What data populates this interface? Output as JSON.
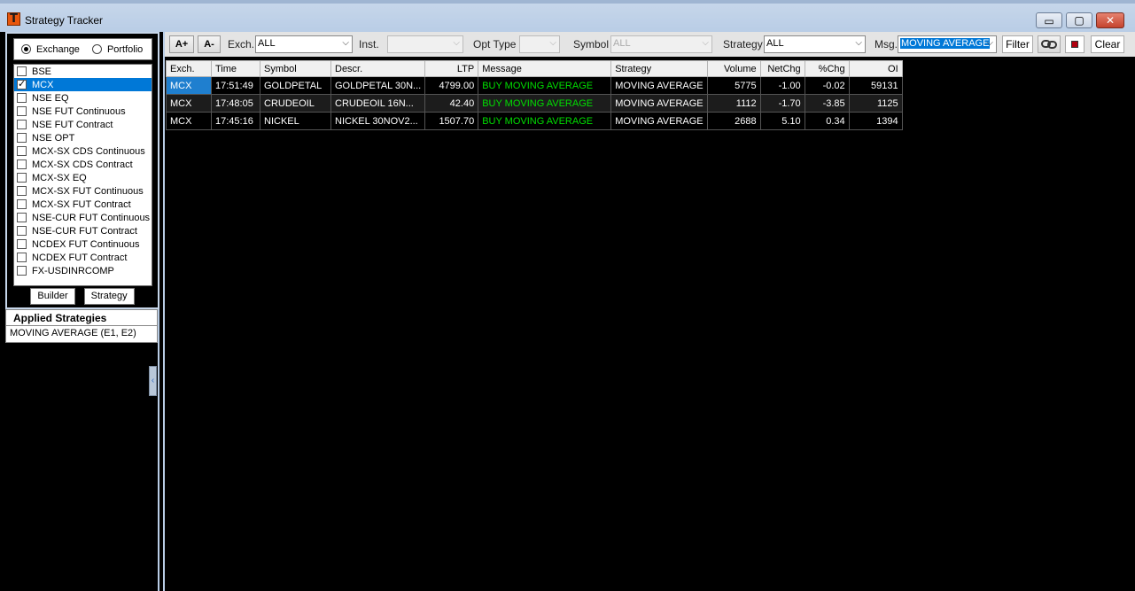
{
  "window": {
    "title": "Strategy Tracker",
    "icon": "T",
    "minimize": "▭",
    "maximize": "▢",
    "close": "✕"
  },
  "left": {
    "mode_options": [
      {
        "label": "Exchange",
        "selected": true
      },
      {
        "label": "Portfolio",
        "selected": false
      }
    ],
    "exchanges": [
      {
        "label": "BSE",
        "checked": false,
        "selected": false
      },
      {
        "label": "MCX",
        "checked": true,
        "selected": true
      },
      {
        "label": "NSE EQ",
        "checked": false,
        "selected": false
      },
      {
        "label": "NSE FUT Continuous",
        "checked": false,
        "selected": false
      },
      {
        "label": "NSE FUT Contract",
        "checked": false,
        "selected": false
      },
      {
        "label": "NSE OPT",
        "checked": false,
        "selected": false
      },
      {
        "label": "MCX-SX CDS Continuous",
        "checked": false,
        "selected": false
      },
      {
        "label": "MCX-SX CDS Contract",
        "checked": false,
        "selected": false
      },
      {
        "label": "MCX-SX EQ",
        "checked": false,
        "selected": false
      },
      {
        "label": "MCX-SX FUT Continuous",
        "checked": false,
        "selected": false
      },
      {
        "label": "MCX-SX FUT Contract",
        "checked": false,
        "selected": false
      },
      {
        "label": "NSE-CUR FUT Continuous",
        "checked": false,
        "selected": false
      },
      {
        "label": "NSE-CUR FUT Contract",
        "checked": false,
        "selected": false
      },
      {
        "label": "NCDEX FUT Continuous",
        "checked": false,
        "selected": false
      },
      {
        "label": "NCDEX FUT Contract",
        "checked": false,
        "selected": false
      },
      {
        "label": "FX-USDINRCOMP",
        "checked": false,
        "selected": false
      }
    ],
    "builder_label": "Builder",
    "strategy_label": "Strategy",
    "applied_title": "Applied Strategies",
    "applied_items": [
      "MOVING AVERAGE (E1, E2)"
    ],
    "collapse_glyph": "‹"
  },
  "toolbar": {
    "font_increase": "A+",
    "font_decrease": "A-",
    "exch_label": "Exch.",
    "exch_value": "ALL",
    "inst_label": "Inst.",
    "inst_value": "",
    "opttype_label": "Opt Type",
    "opttype_value": "",
    "symbol_label": "Symbol",
    "symbol_value": "ALL",
    "strategy_label": "Strategy",
    "strategy_value": "ALL",
    "msg_label": "Msg.",
    "msg_value": "MOVING AVERAGE",
    "filter_label": "Filter",
    "clear_label": "Clear",
    "dropdown_glyph": "⌵"
  },
  "table": {
    "columns": [
      "Exch.",
      "Time",
      "Symbol",
      "Descr.",
      "LTP",
      "Message",
      "Strategy",
      "Volume",
      "NetChg",
      "%Chg",
      "OI"
    ],
    "rows": [
      [
        "MCX",
        "17:51:49",
        "GOLDPETAL",
        "GOLDPETAL 30N...",
        "4799.00",
        "BUY MOVING AVERAGE",
        "MOVING AVERAGE",
        "5775",
        "-1.00",
        "-0.02",
        "59131"
      ],
      [
        "MCX",
        "17:48:05",
        "CRUDEOIL",
        "CRUDEOIL 16N...",
        "42.40",
        "BUY MOVING AVERAGE",
        "MOVING AVERAGE",
        "1112",
        "-1.70",
        "-3.85",
        "1125"
      ],
      [
        "MCX",
        "17:45:16",
        "NICKEL",
        "NICKEL 30NOV2...",
        "1507.70",
        "BUY MOVING AVERAGE",
        "MOVING AVERAGE",
        "2688",
        "5.10",
        "0.34",
        "1394"
      ]
    ]
  },
  "colors": {
    "message_text": "#00e000",
    "selection": "#0078d7",
    "background": "#000000"
  }
}
